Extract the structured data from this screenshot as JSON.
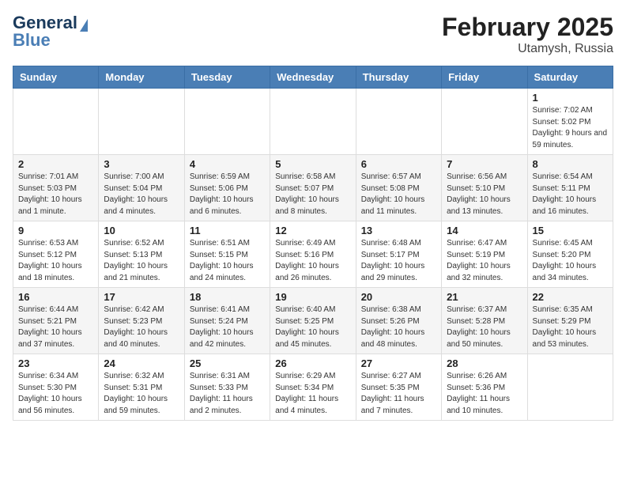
{
  "header": {
    "logo_line1": "General",
    "logo_line2": "Blue",
    "title": "February 2025",
    "subtitle": "Utamysh, Russia"
  },
  "days_of_week": [
    "Sunday",
    "Monday",
    "Tuesday",
    "Wednesday",
    "Thursday",
    "Friday",
    "Saturday"
  ],
  "weeks": [
    [
      {
        "day": "",
        "info": ""
      },
      {
        "day": "",
        "info": ""
      },
      {
        "day": "",
        "info": ""
      },
      {
        "day": "",
        "info": ""
      },
      {
        "day": "",
        "info": ""
      },
      {
        "day": "",
        "info": ""
      },
      {
        "day": "1",
        "info": "Sunrise: 7:02 AM\nSunset: 5:02 PM\nDaylight: 9 hours and 59 minutes."
      }
    ],
    [
      {
        "day": "2",
        "info": "Sunrise: 7:01 AM\nSunset: 5:03 PM\nDaylight: 10 hours and 1 minute."
      },
      {
        "day": "3",
        "info": "Sunrise: 7:00 AM\nSunset: 5:04 PM\nDaylight: 10 hours and 4 minutes."
      },
      {
        "day": "4",
        "info": "Sunrise: 6:59 AM\nSunset: 5:06 PM\nDaylight: 10 hours and 6 minutes."
      },
      {
        "day": "5",
        "info": "Sunrise: 6:58 AM\nSunset: 5:07 PM\nDaylight: 10 hours and 8 minutes."
      },
      {
        "day": "6",
        "info": "Sunrise: 6:57 AM\nSunset: 5:08 PM\nDaylight: 10 hours and 11 minutes."
      },
      {
        "day": "7",
        "info": "Sunrise: 6:56 AM\nSunset: 5:10 PM\nDaylight: 10 hours and 13 minutes."
      },
      {
        "day": "8",
        "info": "Sunrise: 6:54 AM\nSunset: 5:11 PM\nDaylight: 10 hours and 16 minutes."
      }
    ],
    [
      {
        "day": "9",
        "info": "Sunrise: 6:53 AM\nSunset: 5:12 PM\nDaylight: 10 hours and 18 minutes."
      },
      {
        "day": "10",
        "info": "Sunrise: 6:52 AM\nSunset: 5:13 PM\nDaylight: 10 hours and 21 minutes."
      },
      {
        "day": "11",
        "info": "Sunrise: 6:51 AM\nSunset: 5:15 PM\nDaylight: 10 hours and 24 minutes."
      },
      {
        "day": "12",
        "info": "Sunrise: 6:49 AM\nSunset: 5:16 PM\nDaylight: 10 hours and 26 minutes."
      },
      {
        "day": "13",
        "info": "Sunrise: 6:48 AM\nSunset: 5:17 PM\nDaylight: 10 hours and 29 minutes."
      },
      {
        "day": "14",
        "info": "Sunrise: 6:47 AM\nSunset: 5:19 PM\nDaylight: 10 hours and 32 minutes."
      },
      {
        "day": "15",
        "info": "Sunrise: 6:45 AM\nSunset: 5:20 PM\nDaylight: 10 hours and 34 minutes."
      }
    ],
    [
      {
        "day": "16",
        "info": "Sunrise: 6:44 AM\nSunset: 5:21 PM\nDaylight: 10 hours and 37 minutes."
      },
      {
        "day": "17",
        "info": "Sunrise: 6:42 AM\nSunset: 5:23 PM\nDaylight: 10 hours and 40 minutes."
      },
      {
        "day": "18",
        "info": "Sunrise: 6:41 AM\nSunset: 5:24 PM\nDaylight: 10 hours and 42 minutes."
      },
      {
        "day": "19",
        "info": "Sunrise: 6:40 AM\nSunset: 5:25 PM\nDaylight: 10 hours and 45 minutes."
      },
      {
        "day": "20",
        "info": "Sunrise: 6:38 AM\nSunset: 5:26 PM\nDaylight: 10 hours and 48 minutes."
      },
      {
        "day": "21",
        "info": "Sunrise: 6:37 AM\nSunset: 5:28 PM\nDaylight: 10 hours and 50 minutes."
      },
      {
        "day": "22",
        "info": "Sunrise: 6:35 AM\nSunset: 5:29 PM\nDaylight: 10 hours and 53 minutes."
      }
    ],
    [
      {
        "day": "23",
        "info": "Sunrise: 6:34 AM\nSunset: 5:30 PM\nDaylight: 10 hours and 56 minutes."
      },
      {
        "day": "24",
        "info": "Sunrise: 6:32 AM\nSunset: 5:31 PM\nDaylight: 10 hours and 59 minutes."
      },
      {
        "day": "25",
        "info": "Sunrise: 6:31 AM\nSunset: 5:33 PM\nDaylight: 11 hours and 2 minutes."
      },
      {
        "day": "26",
        "info": "Sunrise: 6:29 AM\nSunset: 5:34 PM\nDaylight: 11 hours and 4 minutes."
      },
      {
        "day": "27",
        "info": "Sunrise: 6:27 AM\nSunset: 5:35 PM\nDaylight: 11 hours and 7 minutes."
      },
      {
        "day": "28",
        "info": "Sunrise: 6:26 AM\nSunset: 5:36 PM\nDaylight: 11 hours and 10 minutes."
      },
      {
        "day": "",
        "info": ""
      }
    ]
  ]
}
